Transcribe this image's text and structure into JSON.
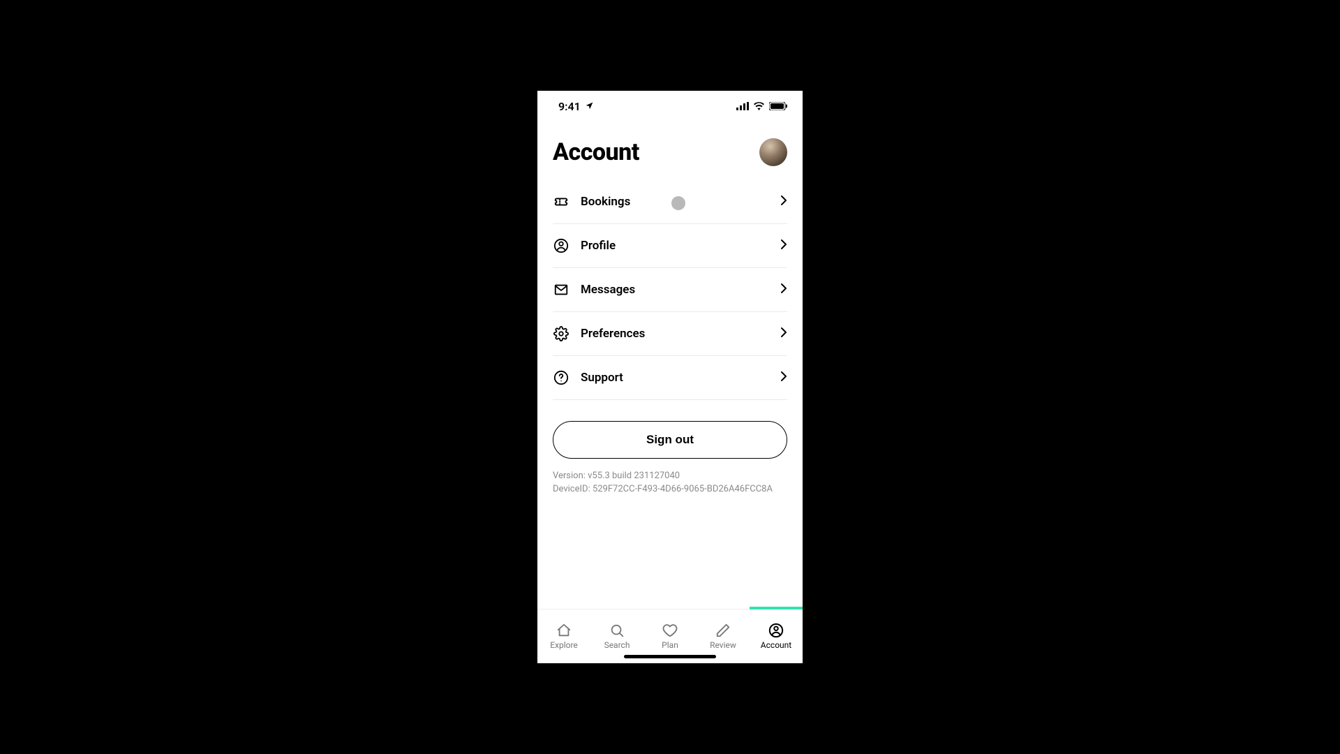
{
  "status_bar": {
    "time": "9:41"
  },
  "header": {
    "title": "Account"
  },
  "menu": {
    "items": [
      {
        "label": "Bookings",
        "icon": "ticket-icon"
      },
      {
        "label": "Profile",
        "icon": "person-circle-icon"
      },
      {
        "label": "Messages",
        "icon": "envelope-icon"
      },
      {
        "label": "Preferences",
        "icon": "gear-icon"
      },
      {
        "label": "Support",
        "icon": "help-circle-icon"
      }
    ]
  },
  "signout": {
    "label": "Sign out"
  },
  "meta": {
    "version_line": "Version: v55.3 build 231127040",
    "device_line": "DeviceID: 529F72CC-F493-4D66-9065-BD26A46FCC8A"
  },
  "tabbar": {
    "accent_color": "#2fe3b0",
    "tabs": [
      {
        "label": "Explore",
        "icon": "home-icon",
        "active": false
      },
      {
        "label": "Search",
        "icon": "search-icon",
        "active": false
      },
      {
        "label": "Plan",
        "icon": "heart-icon",
        "active": false
      },
      {
        "label": "Review",
        "icon": "pencil-icon",
        "active": false
      },
      {
        "label": "Account",
        "icon": "person-circle-icon",
        "active": true
      }
    ]
  }
}
